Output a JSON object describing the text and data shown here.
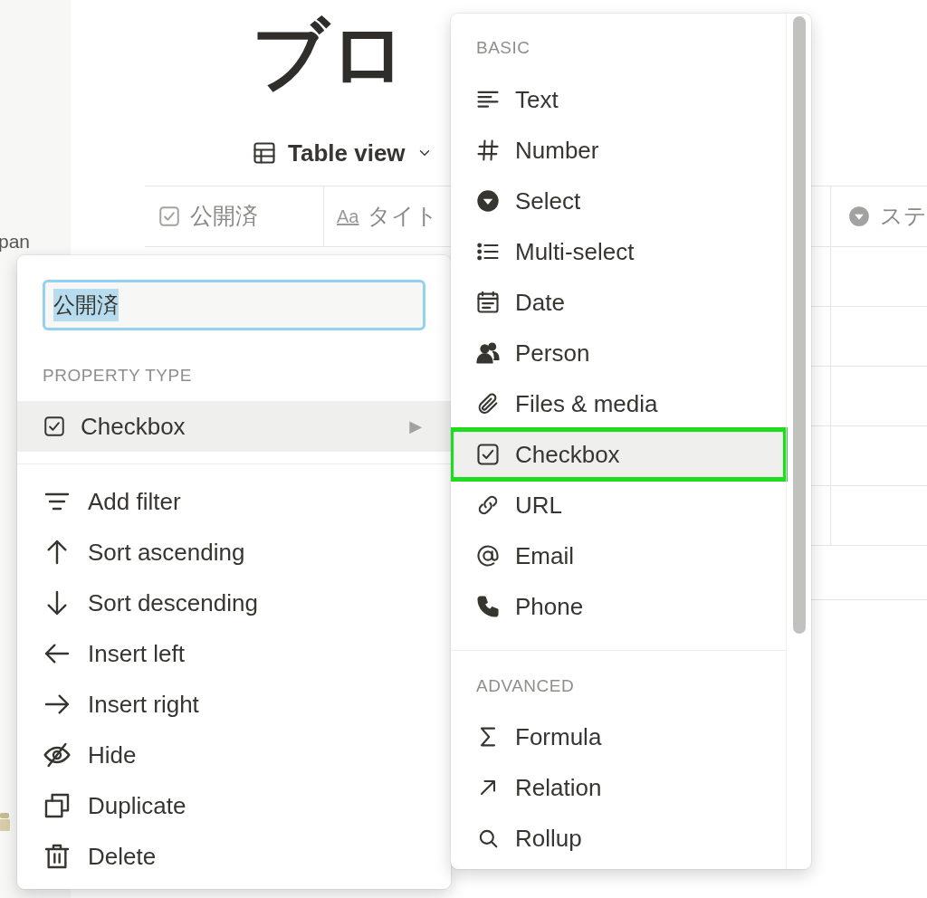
{
  "sidebar": {
    "items": [
      {
        "label": "pan"
      }
    ]
  },
  "page": {
    "title": "ブロ",
    "view": {
      "label": "Table view"
    }
  },
  "table": {
    "columns": [
      {
        "label": "公開済"
      },
      {
        "icon_text": "Aa",
        "label": "タイト"
      },
      {
        "label": "ステ"
      }
    ]
  },
  "property_menu": {
    "name": {
      "value": "公開済",
      "text_selected": true
    },
    "section": "PROPERTY TYPE",
    "type": {
      "label": "Checkbox",
      "arrow": "▶",
      "selected": true
    },
    "actions": [
      {
        "label": "Add filter"
      },
      {
        "label": "Sort ascending"
      },
      {
        "label": "Sort descending"
      },
      {
        "label": "Insert left"
      },
      {
        "label": "Insert right"
      },
      {
        "label": "Hide"
      },
      {
        "label": "Duplicate"
      },
      {
        "label": "Delete"
      }
    ]
  },
  "type_menu": {
    "sections": [
      {
        "title": "BASIC",
        "items": [
          {
            "label": "Text",
            "selected": false
          },
          {
            "label": "Number",
            "selected": false
          },
          {
            "label": "Select",
            "selected": false
          },
          {
            "label": "Multi-select",
            "selected": false
          },
          {
            "label": "Date",
            "selected": false
          },
          {
            "label": "Person",
            "selected": false
          },
          {
            "label": "Files & media",
            "selected": false
          },
          {
            "label": "Checkbox",
            "selected": true
          },
          {
            "label": "URL",
            "selected": false
          },
          {
            "label": "Email",
            "selected": false
          },
          {
            "label": "Phone",
            "selected": false
          }
        ]
      },
      {
        "title": "ADVANCED",
        "items": [
          {
            "label": "Formula",
            "selected": false
          },
          {
            "label": "Relation",
            "selected": false
          },
          {
            "label": "Rollup",
            "selected": false
          }
        ]
      }
    ]
  }
}
